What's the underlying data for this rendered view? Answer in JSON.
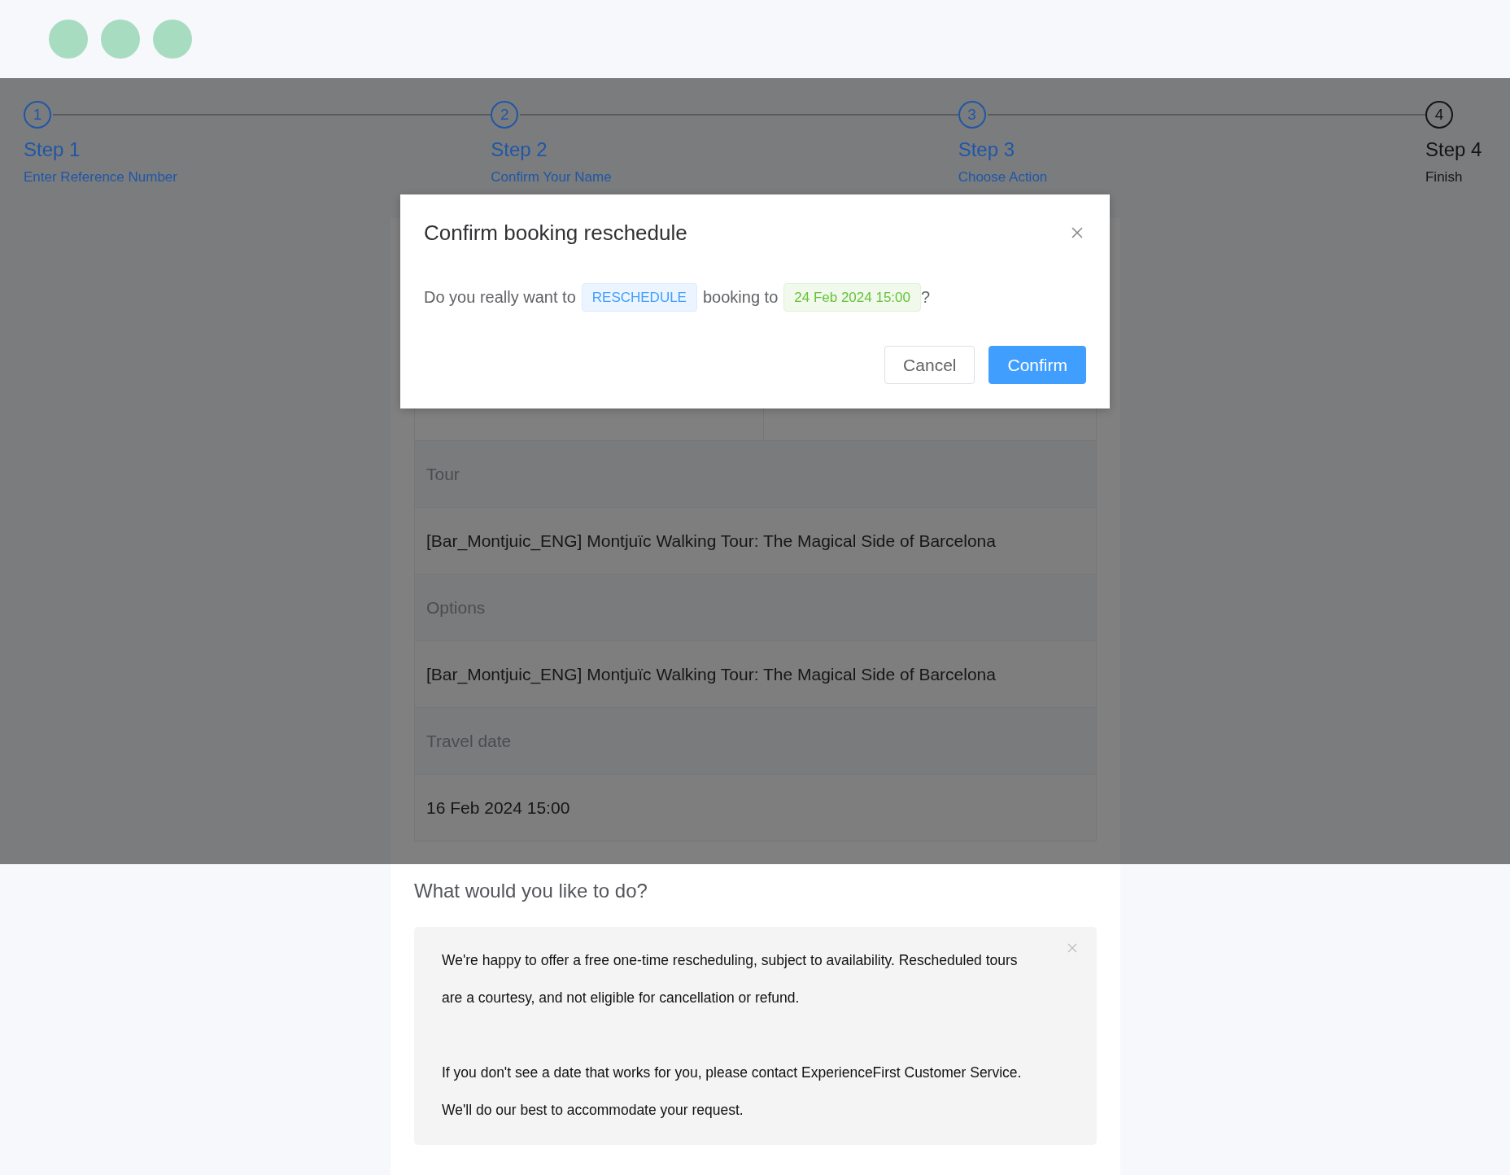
{
  "steps": [
    {
      "number": "1",
      "title": "Step 1",
      "subtitle": "Enter Reference Number",
      "completed": true
    },
    {
      "number": "2",
      "title": "Step 2",
      "subtitle": "Confirm Your Name",
      "completed": true
    },
    {
      "number": "3",
      "title": "Step 3",
      "subtitle": "Choose Action",
      "completed": true
    },
    {
      "number": "4",
      "title": "Step 4",
      "subtitle": "Finish",
      "completed": false
    }
  ],
  "booking_table": {
    "rows": [
      {
        "kind": "label",
        "text": "Tour"
      },
      {
        "kind": "value",
        "text": "[Bar_Montjuic_ENG] Montjuïc Walking Tour: The Magical Side of Barcelona"
      },
      {
        "kind": "label",
        "text": "Options"
      },
      {
        "kind": "value",
        "text": "[Bar_Montjuic_ENG] Montjuïc Walking Tour: The Magical Side of Barcelona"
      },
      {
        "kind": "label",
        "text": "Travel date"
      },
      {
        "kind": "value",
        "text": "16 Feb 2024 15:00"
      }
    ]
  },
  "dialog": {
    "title": "Confirm booking reschedule",
    "message_start": "Do you really want to",
    "action_tag": "RESCHEDULE",
    "message_middle": "booking to",
    "date_tag": "24 Feb 2024 15:00",
    "message_end": "?",
    "buttons": [
      {
        "label": "Cancel",
        "kind": "default"
      },
      {
        "label": "Confirm",
        "kind": "primary"
      }
    ]
  },
  "section_heading": "What would you like to do?",
  "notice": {
    "paragraphs": [
      [
        "We're happy to offer a free one-time rescheduling, subject to availability. Rescheduled tours",
        "are a courtesy, and not eligible for cancellation or refund."
      ],
      [
        "If you don't see a date that works for you, please contact ExperienceFirst Customer Service.",
        "We'll do our best to accommodate your request."
      ]
    ]
  }
}
